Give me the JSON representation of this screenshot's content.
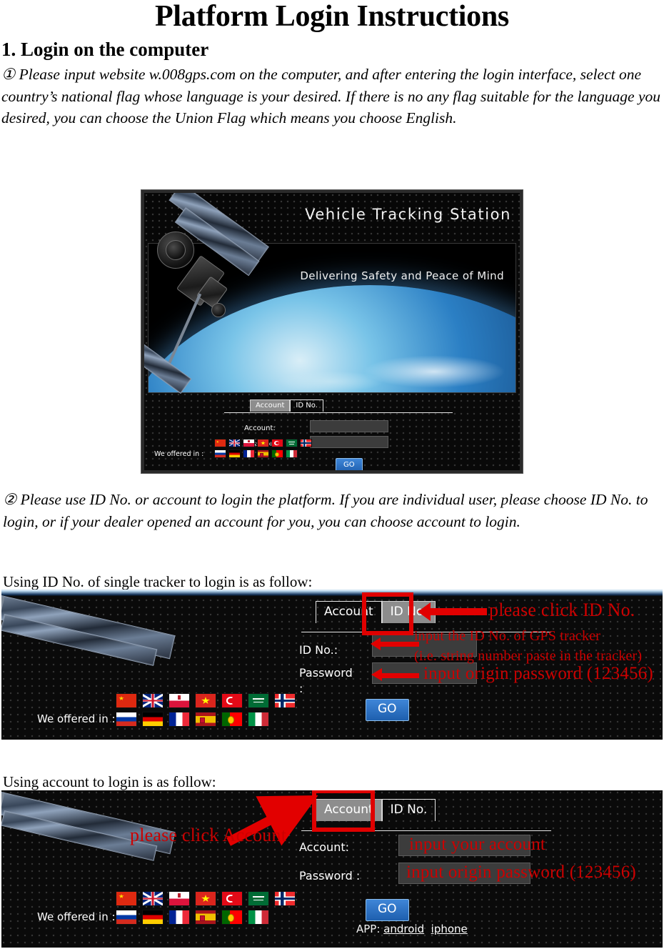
{
  "document": {
    "title": "Platform Login Instructions",
    "section1_heading": "1. Login on the computer",
    "paragraph1": "① Please input website w.008gps.com on the computer, and after entering the login interface, select one country’s national flag whose language is your desired. If there is no any flag suitable for the language you desired, you can choose the Union Flag which means you choose English.",
    "paragraph2": "② Please use ID No. or account to login the platform. If you are individual user, please choose ID No. to login, or if your dealer opened an account for you, you can choose account to login.",
    "caption_id_login": "Using ID No. of single tracker to login is as follow:",
    "caption_account_login": "Using account to login is as follow:"
  },
  "login_screen": {
    "banner_title": "Vehicle Tracking Station",
    "tagline": "Delivering Safety and Peace of Mind",
    "tabs": [
      {
        "label": "Account",
        "state": "active"
      },
      {
        "label": "ID No.",
        "state": "inactive"
      }
    ],
    "fields": {
      "account_label": "Account:",
      "password_label": "Password :",
      "id_no_label": "ID No.:",
      "password_label_wrapped": "Password",
      "password_colon": ":"
    },
    "go_button": "GO",
    "app_prefix": "APP:",
    "app_android": "android",
    "app_iphone": "iphone",
    "flags_label": "We offered in :",
    "flags_row1": [
      "china",
      "united-kingdom",
      "poland",
      "vietnam",
      "turkey",
      "saudi-arabia",
      "norway"
    ],
    "flags_row2": [
      "russia",
      "germany",
      "france",
      "spain",
      "portugal",
      "italy"
    ]
  },
  "annotations": {
    "id_login": {
      "click_id_no": "please click ID No.",
      "input_id_line1": "input the ID No. of GPS tracker",
      "input_id_line2": "(i.e. string number paste in the tracker)",
      "input_password": "input origin password (123456)"
    },
    "account_login": {
      "click_account": "please click Account",
      "input_account": "input your account",
      "input_password": "input origin password (123456)"
    },
    "color": "#cc0000",
    "box_color": "#e00000"
  }
}
